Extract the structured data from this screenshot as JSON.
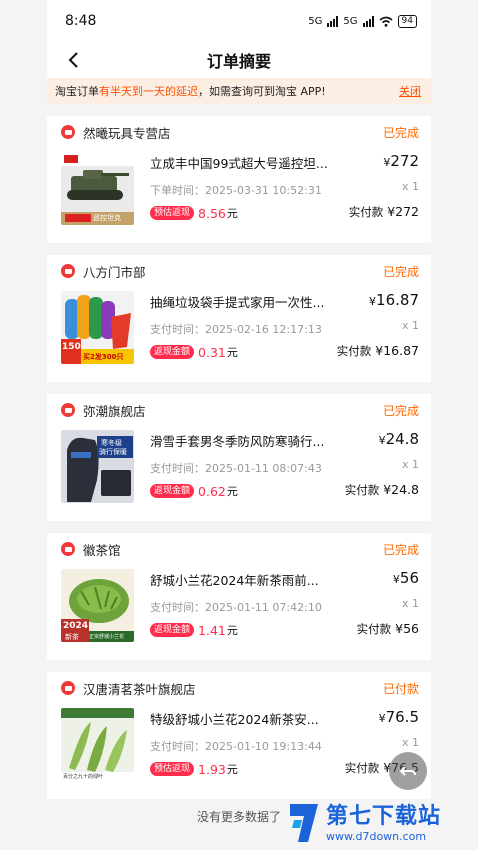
{
  "status_bar": {
    "time": "8:48",
    "net1": "5G",
    "net2": "5G",
    "battery": "94"
  },
  "nav": {
    "title": "订单摘要"
  },
  "notice": {
    "prefix": "淘宝订单",
    "highlight": "有半天到一天的延迟",
    "suffix": "，如需查询可到淘宝 APP!",
    "close": "关闭"
  },
  "orders": [
    {
      "shop": "然曦玩具专营店",
      "status": "已完成",
      "title": "立成丰中国99式超大号遥控坦...",
      "time": "下单时间：2025-03-31 10:52:31",
      "price": "272",
      "qty": "x 1",
      "paid_label": "实付款",
      "paid": "¥272",
      "badge": "预估返现",
      "rebate": "8.56",
      "unit": "元",
      "currency": "¥"
    },
    {
      "shop": "八方门市部",
      "status": "已完成",
      "title": "抽绳垃圾袋手提式家用一次性...",
      "time": "支付时间：2025-02-16 12:17:13",
      "price": "16.87",
      "qty": "x 1",
      "paid_label": "实付款",
      "paid": "¥16.87",
      "badge": "返现金额",
      "rebate": "0.31",
      "unit": "元",
      "currency": "¥"
    },
    {
      "shop": "弥潮旗舰店",
      "status": "已完成",
      "title": "滑雪手套男冬季防风防寒骑行...",
      "time": "支付时间：2025-01-11 08:07:43",
      "price": "24.8",
      "qty": "x 1",
      "paid_label": "实付款",
      "paid": "¥24.8",
      "badge": "返现金额",
      "rebate": "0.62",
      "unit": "元",
      "currency": "¥"
    },
    {
      "shop": "徽茶馆",
      "status": "已完成",
      "title": "舒城小兰花2024年新茶雨前...",
      "time": "支付时间：2025-01-11 07:42:10",
      "price": "56",
      "qty": "x 1",
      "paid_label": "实付款",
      "paid": "¥56",
      "badge": "返现金额",
      "rebate": "1.41",
      "unit": "元",
      "currency": "¥"
    },
    {
      "shop": "汉唐清茗茶叶旗舰店",
      "status": "已付款",
      "title": "特级舒城小兰花2024新茶安...",
      "time": "支付时间：2025-01-10 19:13:44",
      "price": "76.5",
      "qty": "x 1",
      "paid_label": "实付款",
      "paid": "¥76.5",
      "badge": "预估返现",
      "rebate": "1.93",
      "unit": "元",
      "currency": "¥"
    }
  ],
  "thumb_texts": {
    "o1": "遥控坦克",
    "o2a": "150",
    "o2b": "买2发300只",
    "o3a": "寒冬级",
    "o3b": "骑行保暖",
    "o4a": "2024",
    "o4b": "新茶",
    "o4c": "正宗舒城小兰花",
    "o5": "百分之九十的绿叶"
  },
  "footer": {
    "text": "没有更多数据了"
  },
  "watermark": {
    "name": "第七下载站",
    "url": "www.d7down.com"
  },
  "colors": {
    "accent": "#ff6a00",
    "rebate": "#ff2d4b",
    "notice_bg": "#fdeee3"
  }
}
